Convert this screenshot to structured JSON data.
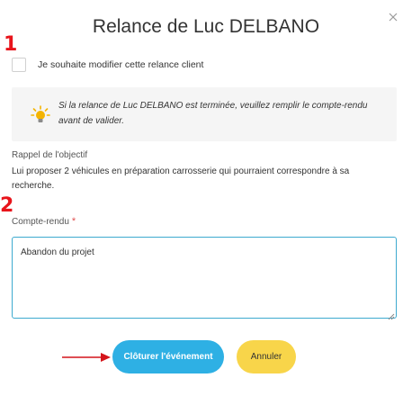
{
  "dialog": {
    "title": "Relance de Luc DELBANO",
    "close_icon": "close-icon"
  },
  "markers": {
    "step1": "1",
    "step2": "2"
  },
  "modify": {
    "label": "Je souhaite modifier cette relance client",
    "checked": false
  },
  "info": {
    "icon": "lightbulb-icon",
    "text": "Si la relance de Luc DELBANO est terminée, veuillez remplir le compte-rendu avant de valider."
  },
  "objective": {
    "label": "Rappel de l'objectif",
    "text": "Lui proposer 2 véhicules en préparation carrosserie qui pourraient correspondre à sa recherche."
  },
  "report": {
    "label": "Compte-rendu",
    "required_mark": "*",
    "value": "Abandon du projet"
  },
  "actions": {
    "confirm_label": "Clôturer l'événement",
    "cancel_label": "Annuler"
  },
  "colors": {
    "accent": "#2eb0e4",
    "cancel": "#f8d54a",
    "marker": "#e8141b",
    "required": "#e05050"
  }
}
